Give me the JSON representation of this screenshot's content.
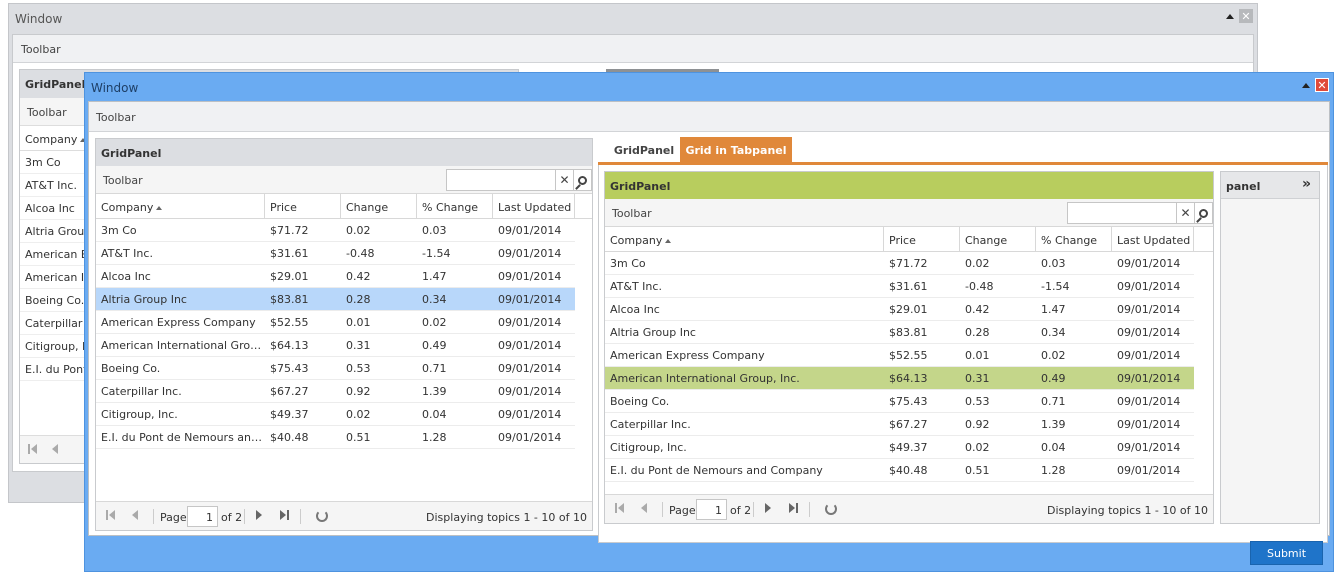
{
  "back_window": {
    "title": "Window",
    "toolbar": "Toolbar",
    "grid": {
      "title": "GridPanel",
      "toolbar": "Toolbar",
      "company_header": "Company",
      "rows": [
        "3m Co",
        "AT&T Inc.",
        "Alcoa Inc",
        "Altria Group Inc",
        "American Express Company",
        "American International Group, Inc.",
        "Boeing Co.",
        "Caterpillar Inc.",
        "Citigroup, Inc.",
        "E.I. du Pont de Nemours and Company"
      ]
    }
  },
  "front_window": {
    "title": "Window",
    "toolbar": "Toolbar",
    "submit_label": "Submit",
    "colors": {
      "frame": "#6aabf2",
      "tab_active": "#e0883a",
      "selected_blue": "#b8d7fa",
      "selected_green": "#c4d68a",
      "green_title": "#b8cd5e"
    },
    "columns": [
      "Company",
      "Price",
      "Change",
      "% Change",
      "Last Updated"
    ],
    "rows": [
      [
        "3m Co",
        "$71.72",
        "0.02",
        "0.03",
        "09/01/2014"
      ],
      [
        "AT&T Inc.",
        "$31.61",
        "-0.48",
        "-1.54",
        "09/01/2014"
      ],
      [
        "Alcoa Inc",
        "$29.01",
        "0.42",
        "1.47",
        "09/01/2014"
      ],
      [
        "Altria Group Inc",
        "$83.81",
        "0.28",
        "0.34",
        "09/01/2014"
      ],
      [
        "American Express Company",
        "$52.55",
        "0.01",
        "0.02",
        "09/01/2014"
      ],
      [
        "American International Group, Inc.",
        "$64.13",
        "0.31",
        "0.49",
        "09/01/2014"
      ],
      [
        "Boeing Co.",
        "$75.43",
        "0.53",
        "0.71",
        "09/01/2014"
      ],
      [
        "Caterpillar Inc.",
        "$67.27",
        "0.92",
        "1.39",
        "09/01/2014"
      ],
      [
        "Citigroup, Inc.",
        "$49.37",
        "0.02",
        "0.04",
        "09/01/2014"
      ],
      [
        "E.I. du Pont de Nemours and Company",
        "$40.48",
        "0.51",
        "1.28",
        "09/01/2014"
      ]
    ],
    "left_grid": {
      "title": "GridPanel",
      "toolbar": "Toolbar",
      "selected_row": 3,
      "pager": {
        "page_label": "Page",
        "page_value": "1",
        "of_label": "of 2",
        "info": "Displaying topics 1 - 10 of 10"
      }
    },
    "tabs": [
      {
        "label": "GridPanel",
        "active": false
      },
      {
        "label": "Grid in Tabpanel",
        "active": true
      }
    ],
    "tab_grid": {
      "title": "GridPanel",
      "toolbar": "Toolbar",
      "selected_row": 5,
      "pager": {
        "page_label": "Page",
        "page_value": "1",
        "of_label": "of 2",
        "info": "Displaying topics 1 - 10 of 10"
      }
    },
    "side_panel": {
      "title": "panel"
    }
  }
}
